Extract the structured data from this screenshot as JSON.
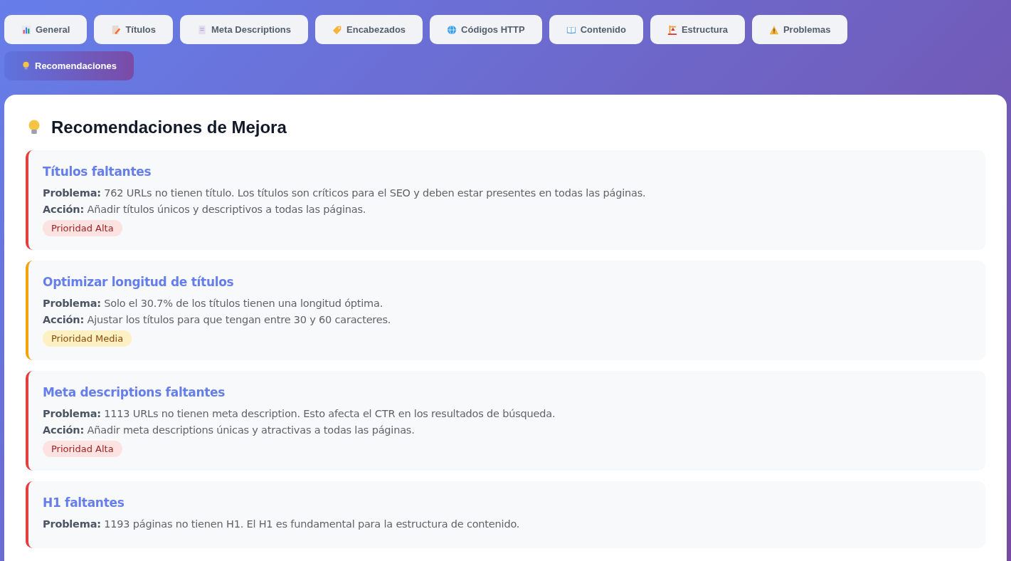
{
  "tabs": [
    {
      "label": "General",
      "selected": false
    },
    {
      "label": "Títulos",
      "selected": false
    },
    {
      "label": "Meta Descriptions",
      "selected": false
    },
    {
      "label": "Encabezados",
      "selected": false
    },
    {
      "label": "Códigos HTTP",
      "selected": false
    },
    {
      "label": "Contenido",
      "selected": false
    },
    {
      "label": "Estructura",
      "selected": false
    },
    {
      "label": "Problemas",
      "selected": false
    },
    {
      "label": "Recomendaciones",
      "selected": true
    }
  ],
  "panel": {
    "title": "Recomendaciones de Mejora",
    "recommendations": [
      {
        "title": "Títulos faltantes",
        "problem": "**Problema:** 762 URLs no tienen título. Los títulos son críticos para el SEO y deben estar presentes en todas las páginas.",
        "action": "**Acción:** Añadir títulos únicos y descriptivos a todas las páginas.",
        "priority": {
          "kind": "high",
          "label": "Prioridad Alta"
        }
      },
      {
        "title": "Optimizar longitud de títulos",
        "problem": "**Problema:** Solo el 30.7% de los títulos tienen una longitud óptima.",
        "action": "**Acción:** Ajustar los títulos para que tengan entre 30 y 60 caracteres.",
        "priority": {
          "kind": "medium",
          "label": "Prioridad Media"
        }
      },
      {
        "title": "Meta descriptions faltantes",
        "problem": "**Problema:** 1113 URLs no tienen meta description. Esto afecta el CTR en los resultados de búsqueda.",
        "action": "**Acción:** Añadir meta descriptions únicas y atractivas a todas las páginas.",
        "priority": {
          "kind": "high",
          "label": "Prioridad Alta"
        }
      },
      {
        "title": "H1 faltantes",
        "problem": "**Problema:** 1193 páginas no tienen H1. El H1 es fundamental para la estructura de contenido."
      }
    ]
  }
}
